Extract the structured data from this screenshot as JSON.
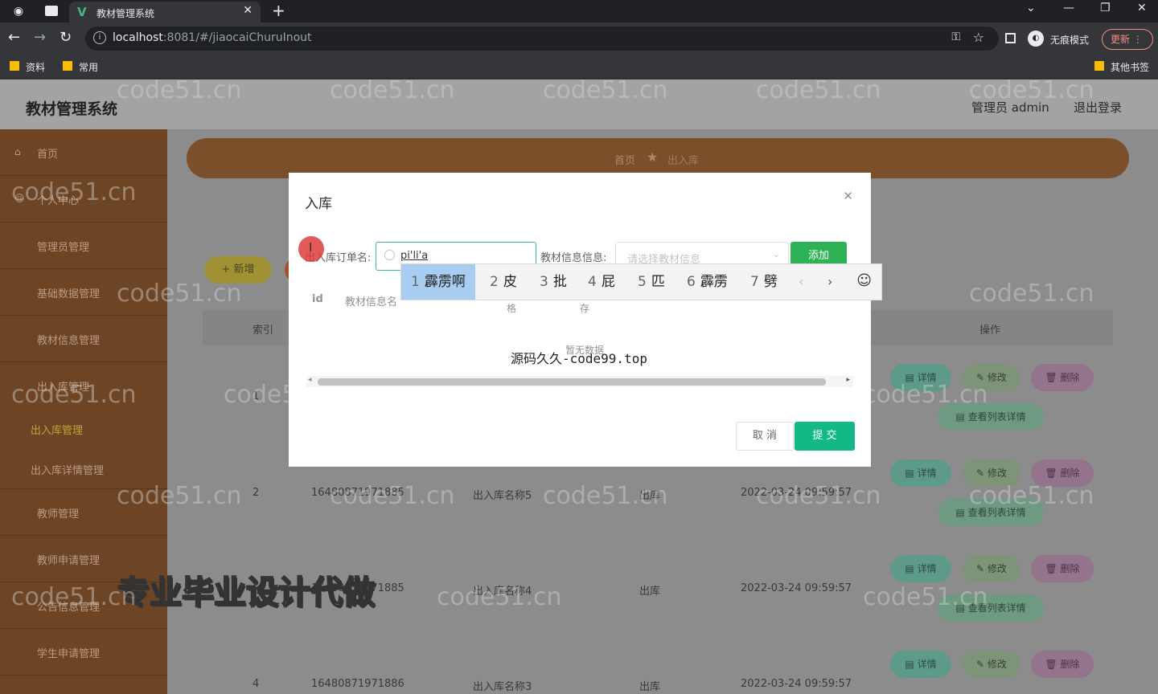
{
  "browser": {
    "tab_title": "教材管理系统",
    "url_host": "localhost",
    "url_rest": ":8081/#/jiaocaiChuruInout",
    "incognito_label": "无痕模式",
    "update_label": "更新",
    "bookmarks": [
      "资料",
      "常用"
    ],
    "other_bookmarks": "其他书签"
  },
  "header": {
    "title": "教材管理系统",
    "user": "管理员 admin",
    "logout": "退出登录"
  },
  "sidebar": {
    "items": [
      "首页",
      "个人中心",
      "管理员管理",
      "基础数据管理",
      "教材信息管理",
      "出入库管理"
    ],
    "sub_items": [
      "出入库管理",
      "出入库详情管理"
    ],
    "items_after": [
      "教师管理",
      "教师申请管理",
      "公告信息管理",
      "学生申请管理"
    ]
  },
  "breadcrumb": {
    "home": "首页",
    "current": "出入库"
  },
  "toolbar": {
    "new_label": "+ 新增"
  },
  "table": {
    "headers": [
      "索引",
      "操作"
    ],
    "rows": [
      {
        "index": "1",
        "code": "",
        "name": "",
        "type": "",
        "time": ""
      },
      {
        "index": "2",
        "code": "16480871971885",
        "name": "出入库名称5",
        "type": "出库",
        "time": "2022-03-24 09:59:57"
      },
      {
        "index": "3",
        "code": "16480871971885",
        "name": "出入库名称4",
        "type": "出库",
        "time": "2022-03-24 09:59:57"
      },
      {
        "index": "4",
        "code": "16480871971886",
        "name": "出入库名称3",
        "type": "出库",
        "time": "2022-03-24 09:59:57"
      }
    ],
    "actions": {
      "detail": "详情",
      "edit": "修改",
      "delete": "删除",
      "list_detail": "查看列表详情"
    }
  },
  "dialog": {
    "title": "入库",
    "order_label": "出入库订单名:",
    "order_value": "pi'li'a",
    "book_label": "教材信息信息:",
    "book_placeholder": "请选择教材信息",
    "add_label": "添加",
    "columns": [
      "id",
      "教材信息名",
      "格",
      "存"
    ],
    "empty_text": "暂无数据",
    "cancel_label": "取 消",
    "submit_label": "提 交"
  },
  "ime": {
    "candidates": [
      {
        "n": "1",
        "text": "霹雳啊"
      },
      {
        "n": "2",
        "text": "皮"
      },
      {
        "n": "3",
        "text": "批"
      },
      {
        "n": "4",
        "text": "屁"
      },
      {
        "n": "5",
        "text": "匹"
      },
      {
        "n": "6",
        "text": "霹雳"
      },
      {
        "n": "7",
        "text": "劈"
      }
    ]
  },
  "overlays": {
    "watermark": "code51.cn",
    "site_mark": "源码久久-code99.top",
    "promo": "专业毕业设计代做"
  }
}
